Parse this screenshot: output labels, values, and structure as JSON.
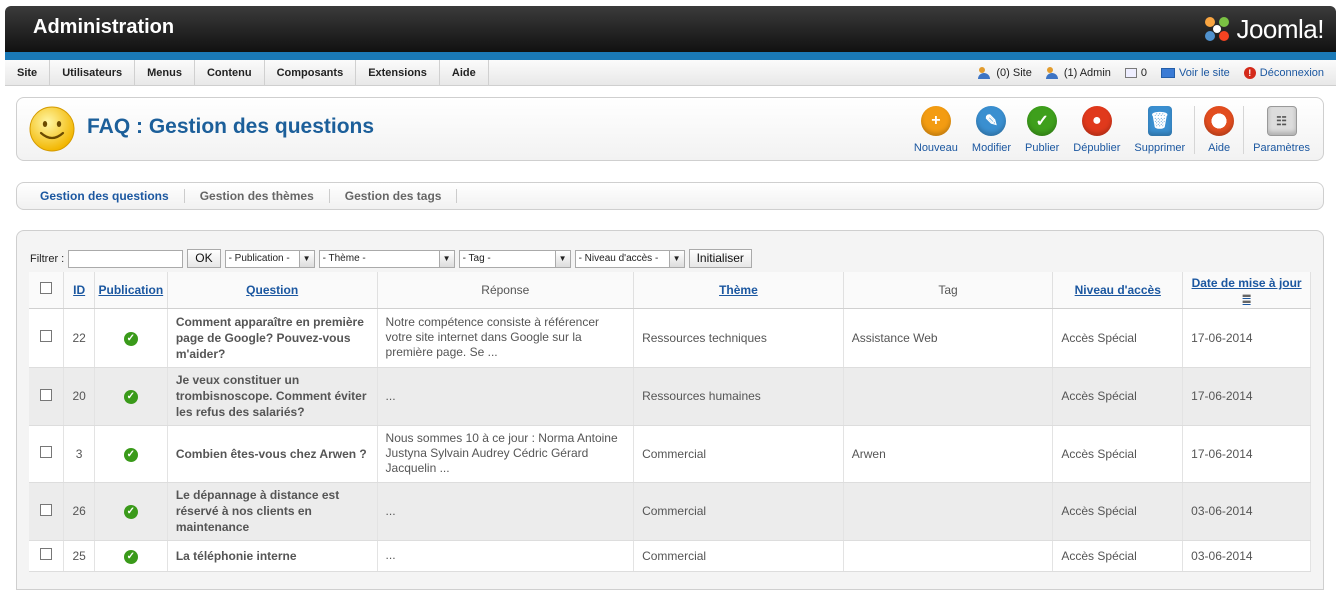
{
  "header": {
    "title": "Administration",
    "logo_text": "Joomla!"
  },
  "menu": [
    "Site",
    "Utilisateurs",
    "Menus",
    "Contenu",
    "Composants",
    "Extensions",
    "Aide"
  ],
  "status": {
    "site": "(0) Site",
    "admin": "(1) Admin",
    "messages": "0",
    "view_site": "Voir le site",
    "logout": "Déconnexion"
  },
  "page": {
    "title": "FAQ : Gestion des questions"
  },
  "toolbar": {
    "new": "Nouveau",
    "edit": "Modifier",
    "publish": "Publier",
    "unpublish": "Dépublier",
    "delete": "Supprimer",
    "help": "Aide",
    "params": "Paramètres"
  },
  "tabs": [
    "Gestion des questions",
    "Gestion des thèmes",
    "Gestion des tags"
  ],
  "filters": {
    "label": "Filtrer :",
    "ok": "OK",
    "publication": "- Publication -",
    "theme": "- Thème -",
    "tag": "- Tag -",
    "access": "- Niveau d'accès -",
    "reset": "Initialiser"
  },
  "columns": [
    "ID",
    "Publication",
    "Question",
    "Réponse",
    "Thème",
    "Tag",
    "Niveau d'accès",
    "Date de mise à jour"
  ],
  "rows": [
    {
      "id": "22",
      "question": "Comment apparaître en première page de Google? Pouvez-vous m'aider?",
      "reponse": "Notre compétence consiste à référencer votre site internet dans Google sur la première page. Se ...",
      "theme": "Ressources techniques",
      "tag": "Assistance Web",
      "access": "Accès Spécial",
      "date": "17-06-2014"
    },
    {
      "id": "20",
      "question": "Je veux constituer un trombisnoscope. Comment éviter les refus des salariés?",
      "reponse": "...",
      "theme": "Ressources humaines",
      "tag": "",
      "access": "Accès Spécial",
      "date": "17-06-2014"
    },
    {
      "id": "3",
      "question": "Combien êtes-vous chez Arwen ?",
      "reponse": "Nous sommes 10 à ce jour : Norma Antoine Justyna Sylvain Audrey Cédric Gérard Jacquelin ...",
      "theme": "Commercial",
      "tag": "Arwen",
      "access": "Accès Spécial",
      "date": "17-06-2014"
    },
    {
      "id": "26",
      "question": "Le dépannage à distance est réservé à nos clients en maintenance",
      "reponse": "...",
      "theme": "Commercial",
      "tag": "",
      "access": "Accès Spécial",
      "date": "03-06-2014"
    },
    {
      "id": "25",
      "question": "La téléphonie interne",
      "reponse": "...",
      "theme": "Commercial",
      "tag": "",
      "access": "Accès Spécial",
      "date": "03-06-2014"
    }
  ]
}
